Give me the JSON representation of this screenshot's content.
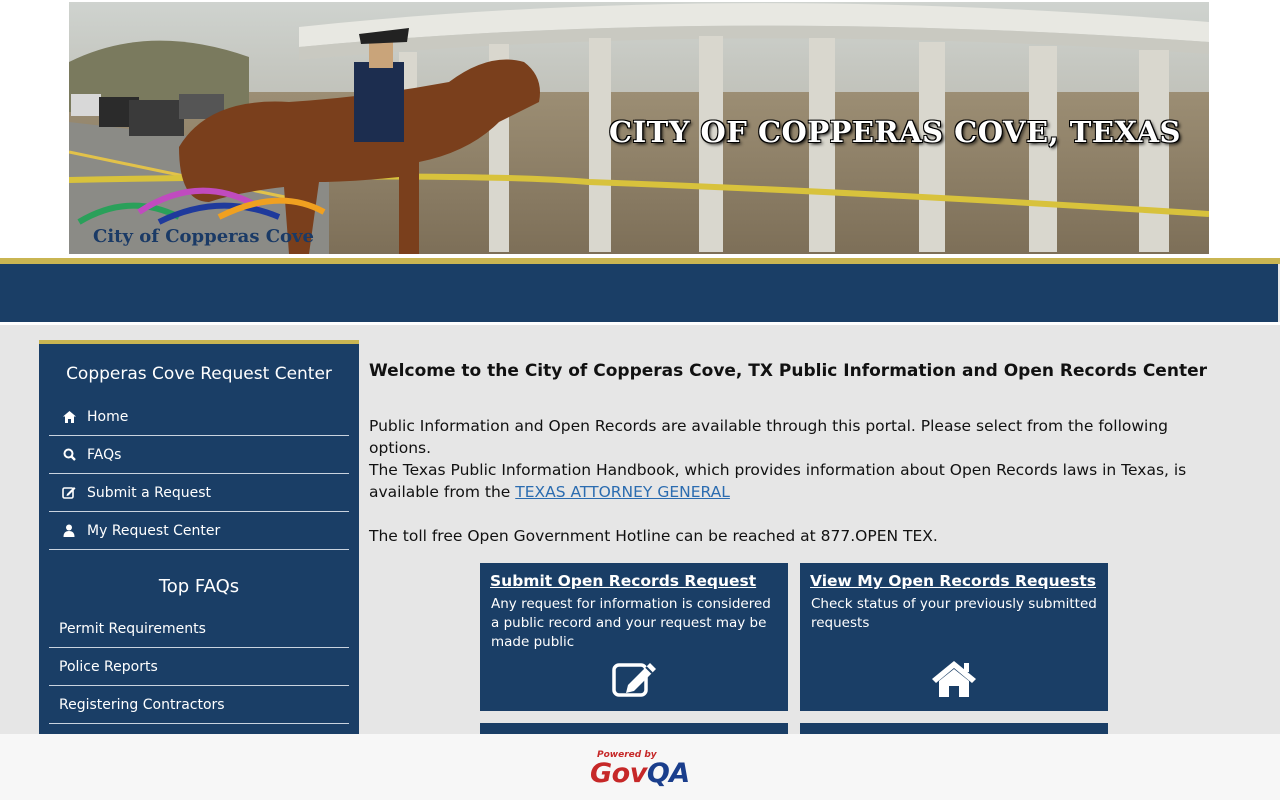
{
  "banner": {
    "title": "CITY OF COPPERAS COVE, TEXAS",
    "logo_text": "City of Copperas Cove"
  },
  "sidebar": {
    "title": "Copperas Cove Request Center",
    "items": [
      {
        "label": "Home",
        "icon": "home-icon"
      },
      {
        "label": "FAQs",
        "icon": "search-icon"
      },
      {
        "label": "Submit a Request",
        "icon": "edit-icon"
      },
      {
        "label": "My Request Center",
        "icon": "user-icon"
      }
    ],
    "faq_title": "Top FAQs",
    "faqs": [
      {
        "label": "Permit Requirements"
      },
      {
        "label": "Police Reports"
      },
      {
        "label": "Registering Contractors"
      }
    ]
  },
  "main": {
    "welcome": "Welcome to the City of Copperas Cove, TX Public Information and Open Records Center",
    "intro": "Public Information and Open Records are available through this portal. Please select from the following options.",
    "handbook_text": "The Texas Public Information Handbook, which provides information about Open Records laws in Texas, is available from the ",
    "handbook_link": "TEXAS ATTORNEY GENERAL",
    "hotline": "The toll free Open Government Hotline can be reached at 877.OPEN TEX.",
    "cards": [
      {
        "title": "Submit Open Records Request",
        "desc": "Any request for information is considered a public record and your request may be made public",
        "icon": "edit-icon"
      },
      {
        "title": "View My Open Records Requests",
        "desc": "Check status of your previously submitted requests",
        "icon": "home-icon"
      }
    ]
  },
  "footer": {
    "powered_by": "Powered by",
    "brand_gov": "Gov",
    "brand_qa": "QA"
  },
  "colors": {
    "navy": "#1a3e66",
    "gold": "#c9b552",
    "link": "#2b6cb0",
    "govqa_red": "#c62828",
    "govqa_blue": "#1a3e8c"
  }
}
